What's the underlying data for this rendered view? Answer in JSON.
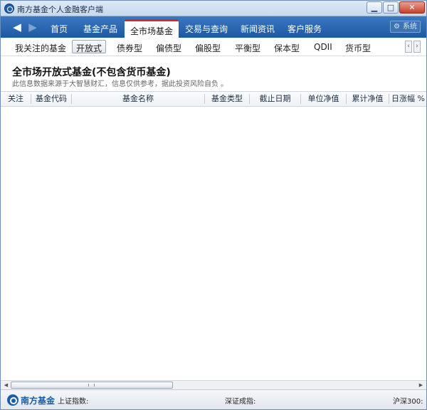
{
  "window": {
    "title": "南方基金个人金融客户端",
    "min_glyph": "▁",
    "max_glyph": "□",
    "close_glyph": "✕"
  },
  "nav": {
    "back_glyph": "◀",
    "forward_glyph": "▶",
    "tabs": [
      "首页",
      "基金产品",
      "全市场基金",
      "交易与查询",
      "新闻资讯",
      "客户服务"
    ],
    "active_index": 2,
    "system_label": "系统",
    "system_icon": "gear-icon"
  },
  "subnav": {
    "tabs": [
      "我关注的基金",
      "开放式",
      "债券型",
      "偏债型",
      "偏股型",
      "平衡型",
      "保本型",
      "QDII",
      "货币型"
    ],
    "active_index": 1
  },
  "content": {
    "title": "全市场开放式基金(不包含货币基金)",
    "disclaimer": "此信息数据来源于大智慧财汇，信息仅供参考，据此投资风险自负 。"
  },
  "table": {
    "columns": [
      "关注",
      "基金代码",
      "基金名称",
      "基金类型",
      "截止日期",
      "单位净值",
      "累计净值",
      "日涨幅 %"
    ],
    "rows": []
  },
  "status": {
    "brand": "南方基金",
    "sh_label": "上证指数:",
    "sz_label": "深证成指:",
    "hs300_label": "沪深300:"
  },
  "colors": {
    "nav_blue": "#2a68b2",
    "active_tab_accent": "#d42a2a",
    "brand_blue": "#1a5ea8"
  }
}
